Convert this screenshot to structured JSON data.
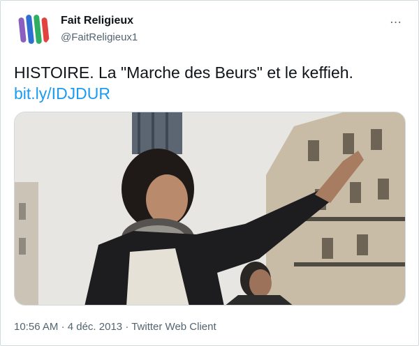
{
  "tweet": {
    "author_name": "Fait Religieux",
    "handle": "@FaitReligieux1",
    "more_icon": "…",
    "text": "HISTOIRE. La \"Marche des Beurs\" et le keffieh.",
    "link": "bit.ly/IDJDUR",
    "time": "10:56 AM",
    "separator": "·",
    "date": "4 déc. 2013",
    "client": "Twitter Web Client"
  },
  "avatar": {
    "stripe_colors": [
      "#8b5fbf",
      "#2e6fd1",
      "#2fae61",
      "#e0443e"
    ]
  },
  "colors": {
    "link": "#1d9bf0",
    "secondary_text": "#536471",
    "border": "#cfd9de"
  }
}
